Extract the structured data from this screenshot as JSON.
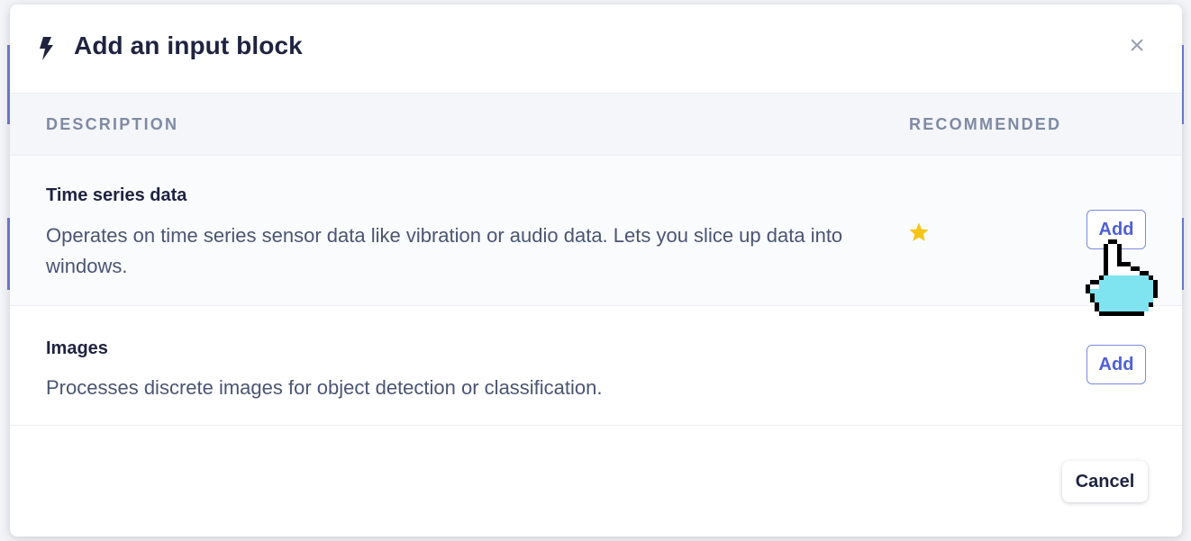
{
  "modal": {
    "title": "Add an input block",
    "header_icon": "bolt-icon",
    "close_label": "×"
  },
  "table": {
    "headers": {
      "description": "DESCRIPTION",
      "recommended": "RECOMMENDED"
    },
    "rows": [
      {
        "title": "Time series data",
        "description": "Operates on time series sensor data like vibration or audio data. Lets you slice up data into windows.",
        "recommended": true,
        "recommended_icon": "star-icon",
        "action_label": "Add"
      },
      {
        "title": "Images",
        "description": "Processes discrete images for object detection or classification.",
        "recommended": false,
        "action_label": "Add"
      }
    ]
  },
  "footer": {
    "cancel_label": "Cancel"
  },
  "colors": {
    "accent": "#4e5fd6",
    "star": "#f5c518",
    "title_text": "#1f2340",
    "muted_header": "#7f8aa3"
  },
  "cursor_icon": "pointer-hand-icon"
}
